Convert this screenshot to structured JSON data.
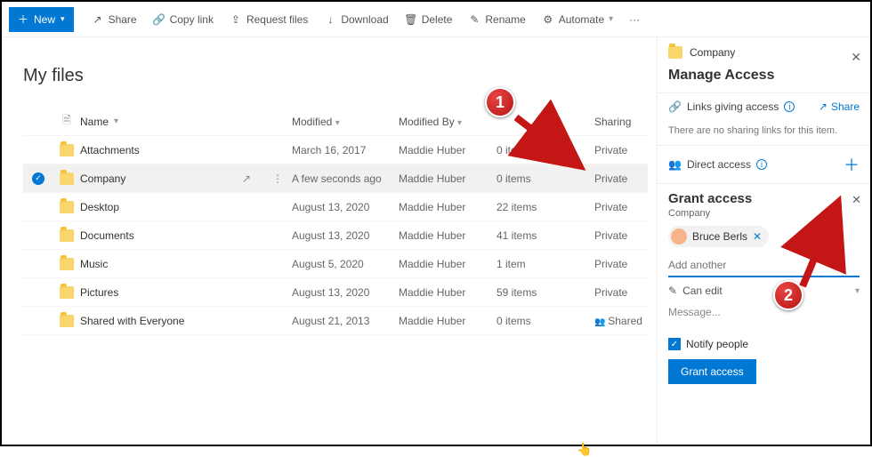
{
  "toolbar": {
    "new": "New",
    "share": "Share",
    "copy_link": "Copy link",
    "request_files": "Request files",
    "download": "Download",
    "delete": "Delete",
    "rename": "Rename",
    "automate": "Automate"
  },
  "page_title": "My files",
  "columns": {
    "name": "Name",
    "modified": "Modified",
    "modified_by": "Modified By",
    "sharing": "Sharing"
  },
  "rows": [
    {
      "name": "Attachments",
      "modified": "March 16, 2017",
      "by": "Maddie Huber",
      "size": "0 items",
      "sharing": "Private",
      "selected": false
    },
    {
      "name": "Company",
      "modified": "A few seconds ago",
      "by": "Maddie Huber",
      "size": "0 items",
      "sharing": "Private",
      "selected": true
    },
    {
      "name": "Desktop",
      "modified": "August 13, 2020",
      "by": "Maddie Huber",
      "size": "22 items",
      "sharing": "Private",
      "selected": false
    },
    {
      "name": "Documents",
      "modified": "August 13, 2020",
      "by": "Maddie Huber",
      "size": "41 items",
      "sharing": "Private",
      "selected": false
    },
    {
      "name": "Music",
      "modified": "August 5, 2020",
      "by": "Maddie Huber",
      "size": "1 item",
      "sharing": "Private",
      "selected": false
    },
    {
      "name": "Pictures",
      "modified": "August 13, 2020",
      "by": "Maddie Huber",
      "size": "59 items",
      "sharing": "Private",
      "selected": false
    },
    {
      "name": "Shared with Everyone",
      "modified": "August 21, 2013",
      "by": "Maddie Huber",
      "size": "0 items",
      "sharing": "Shared",
      "selected": false
    }
  ],
  "panel": {
    "folder": "Company",
    "title": "Manage Access",
    "links_label": "Links giving access",
    "share": "Share",
    "no_links": "There are no sharing links for this item.",
    "direct_access": "Direct access",
    "grant_title": "Grant access",
    "grant_sub": "Company",
    "chip_name": "Bruce Berls",
    "add_placeholder": "Add another",
    "perm": "Can edit",
    "message": "Message...",
    "notify": "Notify people",
    "grant_btn": "Grant access"
  },
  "annotations": {
    "one": "1",
    "two": "2"
  }
}
